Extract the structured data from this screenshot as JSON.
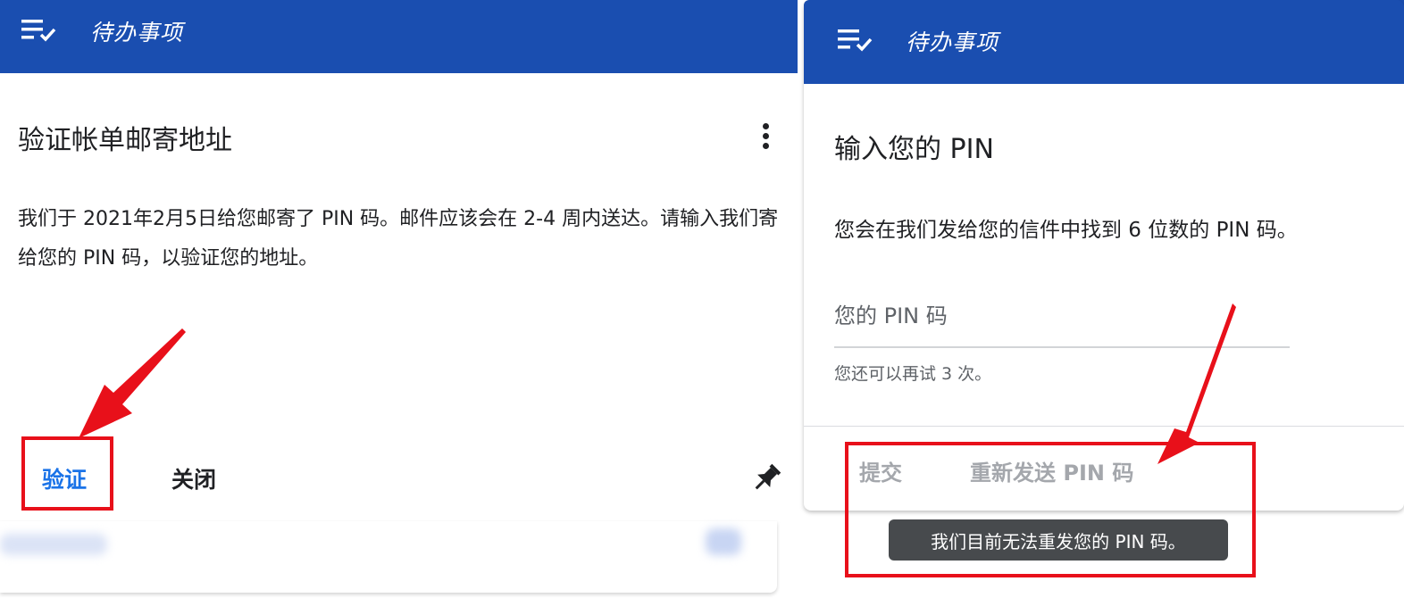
{
  "left_panel": {
    "app_title": "待办事项",
    "card_title": "验证帐单邮寄地址",
    "body_text": "我们于 2021年2月5日给您邮寄了 PIN 码。邮件应该会在 2-4 周内送达。请输入我们寄给您的 PIN 码，以验证您的地址。",
    "verify_label": "验证",
    "close_label": "关闭",
    "icons": {
      "menu": "checklist-icon",
      "more": "more-vert-icon",
      "pin": "push-pin-icon"
    }
  },
  "right_panel": {
    "app_title": "待办事项",
    "card_title": "输入您的 PIN",
    "body_text": "您会在我们发给您的信件中找到 6 位数的 PIN 码。",
    "pin_placeholder": "您的 PIN 码",
    "pin_value": "",
    "attempts_text": "您还可以再试 3 次。",
    "submit_label": "提交",
    "resend_label": "重新发送 PIN 码",
    "tooltip_text": "我们目前无法重发您的 PIN 码。"
  },
  "colors": {
    "appbar": "#1a4eb0",
    "primary_action": "#1a73e8",
    "disabled_action": "#a4a7ac",
    "annotation": "#e8101a",
    "tooltip_bg": "#474a4d"
  }
}
